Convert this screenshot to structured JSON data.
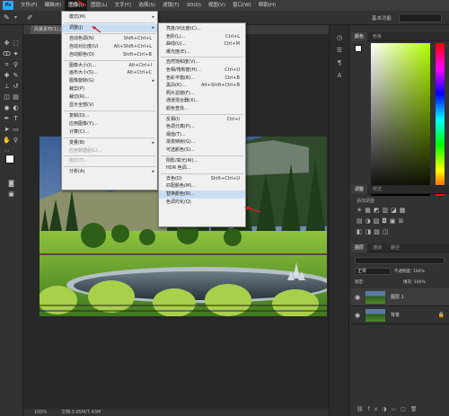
{
  "menubar": {
    "logo": "Ps",
    "items": [
      "文件(F)",
      "编辑(E)",
      "图像(I)",
      "图层(L)",
      "文字(Y)",
      "选择(S)",
      "滤镜(T)",
      "3D(D)",
      "视图(V)",
      "窗口(W)",
      "帮助(H)"
    ],
    "active_index": 2
  },
  "options": {
    "workspace_label": "基本功能"
  },
  "tab": {
    "title": "风景素材(1).jpg @ 100%(RGB/8#)"
  },
  "image_menu": {
    "items": [
      {
        "label": "模式(M)",
        "arrow": "▸"
      },
      {
        "sep": true
      },
      {
        "label": "调整(J)",
        "arrow": "▸",
        "highlight": true
      },
      {
        "sep": true
      },
      {
        "label": "自动色调(N)",
        "shortcut": "Shift+Ctrl+L"
      },
      {
        "label": "自动对比度(U)",
        "shortcut": "Alt+Shift+Ctrl+L"
      },
      {
        "label": "自动颜色(O)",
        "shortcut": "Shift+Ctrl+B"
      },
      {
        "sep": true
      },
      {
        "label": "图像大小(I)...",
        "shortcut": "Alt+Ctrl+I"
      },
      {
        "label": "画布大小(S)...",
        "shortcut": "Alt+Ctrl+C"
      },
      {
        "label": "图像旋转(G)",
        "arrow": "▸"
      },
      {
        "label": "裁剪(P)"
      },
      {
        "label": "裁切(R)..."
      },
      {
        "label": "显示全部(V)"
      },
      {
        "sep": true
      },
      {
        "label": "复制(D)..."
      },
      {
        "label": "应用图像(Y)..."
      },
      {
        "label": "计算(C)..."
      },
      {
        "sep": true
      },
      {
        "label": "变量(B)",
        "arrow": "▸"
      },
      {
        "label": "应用数据组(L)...",
        "disabled": true
      },
      {
        "sep": true
      },
      {
        "label": "陷印(T)...",
        "disabled": true
      },
      {
        "sep": true
      },
      {
        "label": "分析(A)",
        "arrow": "▸"
      }
    ]
  },
  "adjust_menu": {
    "items": [
      {
        "label": "亮度/对比度(C)..."
      },
      {
        "label": "色阶(L)...",
        "shortcut": "Ctrl+L"
      },
      {
        "label": "曲线(U)...",
        "shortcut": "Ctrl+M"
      },
      {
        "label": "曝光度(E)..."
      },
      {
        "sep": true
      },
      {
        "label": "自然饱和度(V)..."
      },
      {
        "label": "色相/饱和度(H)...",
        "shortcut": "Ctrl+U"
      },
      {
        "label": "色彩平衡(B)...",
        "shortcut": "Ctrl+B"
      },
      {
        "label": "黑白(K)...",
        "shortcut": "Alt+Shift+Ctrl+B"
      },
      {
        "label": "照片滤镜(F)..."
      },
      {
        "label": "通道混合器(X)..."
      },
      {
        "label": "颜色查找..."
      },
      {
        "sep": true
      },
      {
        "label": "反相(I)",
        "shortcut": "Ctrl+I"
      },
      {
        "label": "色调分离(P)..."
      },
      {
        "label": "阈值(T)..."
      },
      {
        "label": "渐变映射(G)..."
      },
      {
        "label": "可选颜色(S)..."
      },
      {
        "sep": true
      },
      {
        "label": "阴影/高光(W)..."
      },
      {
        "label": "HDR 色调..."
      },
      {
        "sep": true
      },
      {
        "label": "去色(D)",
        "shortcut": "Shift+Ctrl+U"
      },
      {
        "label": "匹配颜色(M)..."
      },
      {
        "label": "替换颜色(R)...",
        "highlight": true
      },
      {
        "label": "色调均化(Q)"
      }
    ]
  },
  "right_panel": {
    "color_tabs": [
      "颜色",
      "色板"
    ],
    "adjust_tabs": [
      "调整",
      "样式"
    ],
    "adjust_hint": "添加调整",
    "layers_tabs": [
      "图层",
      "通道",
      "路径"
    ],
    "blend_mode": "正常",
    "opacity_label": "不透明度: 100%",
    "fill_label": "填充: 100%",
    "lock_label": "锁定:",
    "layers": [
      {
        "name": "图层 1",
        "selected": true
      },
      {
        "name": "背景",
        "locked": true
      }
    ]
  },
  "status": {
    "zoom": "100%",
    "doc": "文档:3.05M/7.43M"
  },
  "colors": {
    "accent": "#c9def5",
    "arrow": "#d62020",
    "ps_blue": "#31a8ff"
  }
}
